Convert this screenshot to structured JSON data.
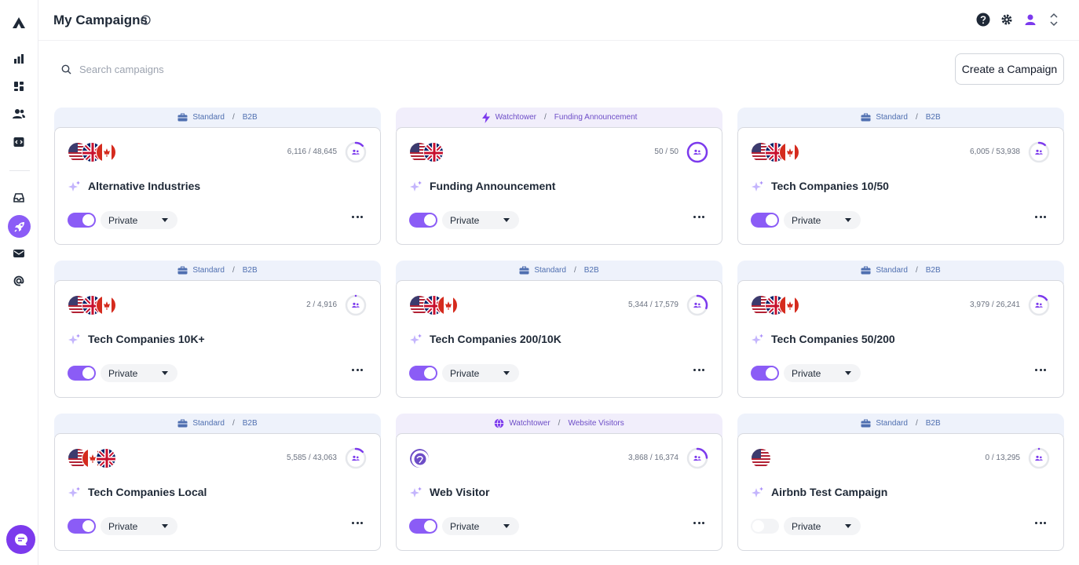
{
  "page": {
    "title": "My Campaigns",
    "search_placeholder": "Search campaigns",
    "create_button": "Create a Campaign"
  },
  "sidebar": {
    "items": [
      {
        "icon": "logo-icon"
      },
      {
        "icon": "bar-chart-icon"
      },
      {
        "icon": "dashboard-icon"
      },
      {
        "icon": "users-icon"
      },
      {
        "icon": "code-icon"
      },
      {
        "icon": "inbox-icon"
      },
      {
        "icon": "rocket-icon",
        "active": true
      },
      {
        "icon": "mail-icon"
      },
      {
        "icon": "at-icon"
      }
    ],
    "chat_icon": "chat-icon"
  },
  "topbar": {
    "icons": [
      "help-icon",
      "gear-icon",
      "user-icon",
      "chevron-updown-icon"
    ]
  },
  "campaigns": [
    {
      "type": "Standard",
      "sub": "B2B",
      "kind": "std",
      "flags": [
        "us",
        "uk",
        "ca"
      ],
      "counts": "6,116 / 48,645",
      "progress": 0.13,
      "name": "Alternative Industries",
      "privacy": "Private",
      "enabled": true
    },
    {
      "type": "Watchtower",
      "sub": "Funding Announcement",
      "kind": "wt-bolt",
      "flags": [
        "us",
        "uk"
      ],
      "counts": "50 / 50",
      "progress": 1.0,
      "name": "Funding Announcement",
      "privacy": "Private",
      "enabled": true
    },
    {
      "type": "Standard",
      "sub": "B2B",
      "kind": "std",
      "flags": [
        "us",
        "uk",
        "ca"
      ],
      "counts": "6,005 / 53,938",
      "progress": 0.11,
      "name": "Tech Companies 10/50",
      "privacy": "Private",
      "enabled": true
    },
    {
      "type": "Standard",
      "sub": "B2B",
      "kind": "std",
      "flags": [
        "us",
        "uk",
        "ca"
      ],
      "counts": "2 / 4,916",
      "progress": 0.0,
      "name": "Tech Companies 10K+",
      "privacy": "Private",
      "enabled": true
    },
    {
      "type": "Standard",
      "sub": "B2B",
      "kind": "std",
      "flags": [
        "us",
        "uk",
        "ca"
      ],
      "counts": "5,344 / 17,579",
      "progress": 0.3,
      "name": "Tech Companies 200/10K",
      "privacy": "Private",
      "enabled": true
    },
    {
      "type": "Standard",
      "sub": "B2B",
      "kind": "std",
      "flags": [
        "us",
        "uk",
        "ca"
      ],
      "counts": "3,979 / 26,241",
      "progress": 0.15,
      "name": "Tech Companies 50/200",
      "privacy": "Private",
      "enabled": true
    },
    {
      "type": "Standard",
      "sub": "B2B",
      "kind": "std",
      "flags": [
        "us",
        "ca",
        "uk"
      ],
      "counts": "5,585 / 43,063",
      "progress": 0.13,
      "name": "Tech Companies Local",
      "privacy": "Private",
      "enabled": true
    },
    {
      "type": "Watchtower",
      "sub": "Website Visitors",
      "kind": "wt-globe",
      "flags": [
        "web"
      ],
      "counts": "3,868 / 16,374",
      "progress": 0.24,
      "name": "Web Visitor",
      "privacy": "Private",
      "enabled": true
    },
    {
      "type": "Standard",
      "sub": "B2B",
      "kind": "std",
      "flags": [
        "us"
      ],
      "counts": "0 / 13,295",
      "progress": 0.0,
      "name": "Airbnb Test Campaign",
      "privacy": "Private",
      "enabled": false
    }
  ],
  "colors": {
    "accent": "#8b5cf6",
    "standard_header": "#eef2fb",
    "watchtower_header": "#f1eefb"
  }
}
